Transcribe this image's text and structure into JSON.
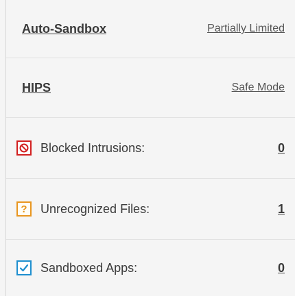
{
  "security_panel": {
    "auto_sandbox": {
      "title": "Auto-Sandbox",
      "status": "Partially Limited"
    },
    "hips": {
      "title": "HIPS",
      "status": "Safe Mode"
    },
    "stats": [
      {
        "label": "Blocked Intrusions:",
        "count": "0",
        "icon": "blocked-icon",
        "color": "#d21f1f"
      },
      {
        "label": "Unrecognized Files:",
        "count": "1",
        "icon": "question-icon",
        "glyph": "?",
        "color": "#e8961e"
      },
      {
        "label": "Sandboxed Apps:",
        "count": "0",
        "icon": "checkmark-icon",
        "color": "#1e8fcf"
      }
    ]
  }
}
